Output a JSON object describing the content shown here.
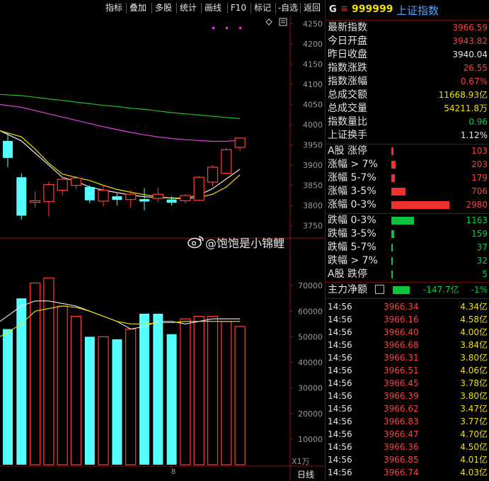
{
  "toolbar": {
    "buttons": [
      "指标",
      "叠加",
      "多股",
      "统计",
      "画线",
      "F10",
      "标记",
      "-自选",
      "返回"
    ]
  },
  "chart": {
    "price_axis_ticks": [
      "4250",
      "4200",
      "4150",
      "4100",
      "4050",
      "4000",
      "3950",
      "3900",
      "3850",
      "3800",
      "3750"
    ],
    "volume_axis_ticks": [
      "70000",
      "60000",
      "50000",
      "40000",
      "30000",
      "20000",
      "10000"
    ],
    "volume_unit": "X1万",
    "period_label": "日线",
    "date_marker": "8",
    "colors": {
      "up": "#ff3c3c",
      "down": "#54ffff",
      "ma_white": "#e8e8e8",
      "ma_yellow": "#f0e000",
      "ma_magenta": "#e040e0",
      "ma_green": "#20c020"
    }
  },
  "chart_data": {
    "type": "candlestick",
    "price_ylim": [
      3725,
      4270
    ],
    "volume_ylim": [
      0,
      80000
    ],
    "candles": [
      {
        "open": 3960,
        "close": 3918,
        "high": 3980,
        "low": 3895
      },
      {
        "open": 3870,
        "close": 3775,
        "high": 3880,
        "low": 3765
      },
      {
        "open": 3808,
        "close": 3812,
        "high": 3835,
        "low": 3795
      },
      {
        "open": 3810,
        "close": 3852,
        "high": 3860,
        "low": 3773
      },
      {
        "open": 3838,
        "close": 3865,
        "high": 3872,
        "low": 3825
      },
      {
        "open": 3850,
        "close": 3868,
        "high": 3873,
        "low": 3840
      },
      {
        "open": 3846,
        "close": 3813,
        "high": 3850,
        "low": 3806
      },
      {
        "open": 3811,
        "close": 3838,
        "high": 3848,
        "low": 3798
      },
      {
        "open": 3823,
        "close": 3814,
        "high": 3830,
        "low": 3800
      },
      {
        "open": 3815,
        "close": 3828,
        "high": 3838,
        "low": 3795
      },
      {
        "open": 3816,
        "close": 3810,
        "high": 3843,
        "low": 3788
      },
      {
        "open": 3818,
        "close": 3828,
        "high": 3845,
        "low": 3808
      },
      {
        "open": 3815,
        "close": 3807,
        "high": 3823,
        "low": 3800
      },
      {
        "open": 3812,
        "close": 3825,
        "high": 3829,
        "low": 3805
      },
      {
        "open": 3813,
        "close": 3870,
        "high": 3874,
        "low": 3811
      },
      {
        "open": 3858,
        "close": 3895,
        "high": 3900,
        "low": 3848
      },
      {
        "open": 3880,
        "close": 3938,
        "high": 3943,
        "low": 3878
      },
      {
        "open": 3944,
        "close": 3967,
        "high": 3969,
        "low": 3935
      }
    ],
    "volumes": [
      {
        "value": 53000,
        "dir": "down"
      },
      {
        "value": 65000,
        "dir": "down"
      },
      {
        "value": 71000,
        "dir": "up"
      },
      {
        "value": 73000,
        "dir": "up"
      },
      {
        "value": 62000,
        "dir": "up"
      },
      {
        "value": 58000,
        "dir": "up"
      },
      {
        "value": 50000,
        "dir": "down"
      },
      {
        "value": 50000,
        "dir": "up"
      },
      {
        "value": 49000,
        "dir": "down"
      },
      {
        "value": 53000,
        "dir": "up"
      },
      {
        "value": 59000,
        "dir": "down"
      },
      {
        "value": 59000,
        "dir": "down"
      },
      {
        "value": 51000,
        "dir": "down"
      },
      {
        "value": 57000,
        "dir": "up"
      },
      {
        "value": 58000,
        "dir": "up"
      },
      {
        "value": 58000,
        "dir": "up"
      },
      {
        "value": 56000,
        "dir": "up"
      },
      {
        "value": 54000,
        "dir": "up"
      }
    ],
    "ma_lines": [
      {
        "name": "ma_green",
        "values": [
          4075,
          4072,
          4068,
          4064,
          4060,
          4056,
          4052,
          4048,
          4045,
          4041,
          4038,
          4034,
          4030,
          4027,
          4024,
          4021,
          4018,
          4015
        ]
      },
      {
        "name": "ma_magenta",
        "values": [
          4050,
          4043,
          4035,
          4027,
          4019,
          4011,
          4003,
          3995,
          3988,
          3981,
          3975,
          3970,
          3966,
          3963,
          3961,
          3959,
          3959,
          3962
        ]
      },
      {
        "name": "ma_white",
        "values": [
          3985,
          3960,
          3930,
          3900,
          3870,
          3860,
          3846,
          3838,
          3832,
          3826,
          3822,
          3820,
          3819,
          3818,
          3826,
          3842,
          3866,
          3890
        ]
      },
      {
        "name": "ma_yellow",
        "values": [
          3985,
          3970,
          3940,
          3905,
          3878,
          3870,
          3862,
          3850,
          3840,
          3833,
          3827,
          3822,
          3818,
          3817,
          3820,
          3828,
          3846,
          3876
        ]
      }
    ],
    "vol_ma_lines": [
      {
        "name": "vol_ma_white",
        "values": [
          56000,
          62000,
          64000,
          64000,
          63000,
          62000,
          60000,
          58000,
          56000,
          53000,
          54000,
          56000,
          56000,
          55000,
          56000,
          57000,
          57000,
          57000
        ]
      },
      {
        "name": "vol_ma_yellow",
        "values": [
          50000,
          55000,
          60000,
          61000,
          62000,
          61500,
          60000,
          58000,
          56000,
          55000,
          55000,
          55500,
          55500,
          56000,
          56000,
          56000,
          56000,
          56000
        ]
      }
    ]
  },
  "panel": {
    "head": {
      "g": "G",
      "menu": "≡",
      "code": "999999",
      "name": "上证指数"
    },
    "stats": [
      {
        "label": "最新指数",
        "value": "3966.59",
        "color": "red"
      },
      {
        "label": "今日开盘",
        "value": "3943.82",
        "color": "red"
      },
      {
        "label": "昨日收盘",
        "value": "3940.04",
        "color": "white"
      },
      {
        "label": "指数涨跌",
        "value": "26.55",
        "color": "red"
      },
      {
        "label": "指数涨幅",
        "value": "0.67%",
        "color": "red"
      },
      {
        "label": "总成交额",
        "value": "11668.93亿",
        "color": "yellow"
      },
      {
        "label": "总成交量",
        "value": "54211.8万",
        "color": "yellow"
      },
      {
        "label": "指数量比",
        "value": "0.96",
        "color": "green"
      },
      {
        "label": "上证换手",
        "value": "1.12%",
        "color": "white"
      }
    ],
    "up_dist": [
      {
        "label": "A股 涨停",
        "value": "103",
        "bar": 0.035
      },
      {
        "label": "涨幅 > 7%",
        "value": "203",
        "bar": 0.068
      },
      {
        "label": "涨幅 5-7%",
        "value": "179",
        "bar": 0.06
      },
      {
        "label": "涨幅 3-5%",
        "value": "706",
        "bar": 0.24
      },
      {
        "label": "涨幅 0-3%",
        "value": "2980",
        "bar": 1.0
      }
    ],
    "down_dist": [
      {
        "label": "跌幅 0-3%",
        "value": "1163",
        "bar": 0.39
      },
      {
        "label": "跌幅 3-5%",
        "value": "159",
        "bar": 0.05
      },
      {
        "label": "跌幅 5-7%",
        "value": "37",
        "bar": 0.015
      },
      {
        "label": "跌幅 > 7%",
        "value": "32",
        "bar": 0.012
      },
      {
        "label": "A股 跌停",
        "value": "5",
        "bar": 0.008
      }
    ],
    "flow": {
      "label": "主力净额",
      "value": "-147.7亿",
      "pct": "-1%",
      "bar": 0.3
    },
    "ticks": [
      {
        "time": "14:56",
        "price": "3966.34",
        "vol": "4.34亿"
      },
      {
        "time": "14:56",
        "price": "3966.16",
        "vol": "4.58亿"
      },
      {
        "time": "14:56",
        "price": "3966.40",
        "vol": "4.00亿"
      },
      {
        "time": "14:56",
        "price": "3966.68",
        "vol": "3.84亿"
      },
      {
        "time": "14:56",
        "price": "3966.31",
        "vol": "3.80亿"
      },
      {
        "time": "14:56",
        "price": "3966.51",
        "vol": "4.06亿"
      },
      {
        "time": "14:56",
        "price": "3966.45",
        "vol": "3.78亿"
      },
      {
        "time": "14:56",
        "price": "3966.39",
        "vol": "3.80亿"
      },
      {
        "time": "14:56",
        "price": "3966.62",
        "vol": "3.47亿"
      },
      {
        "time": "14:56",
        "price": "3966.83",
        "vol": "3.77亿"
      },
      {
        "time": "14:56",
        "price": "3966.47",
        "vol": "4.70亿"
      },
      {
        "time": "14:56",
        "price": "3966.36",
        "vol": "4.50亿"
      },
      {
        "time": "14:56",
        "price": "3966.85",
        "vol": "4.01亿"
      },
      {
        "time": "14:56",
        "price": "3966.74",
        "vol": "4.03亿"
      }
    ]
  },
  "watermark": "@饱饱是小锦鲤"
}
